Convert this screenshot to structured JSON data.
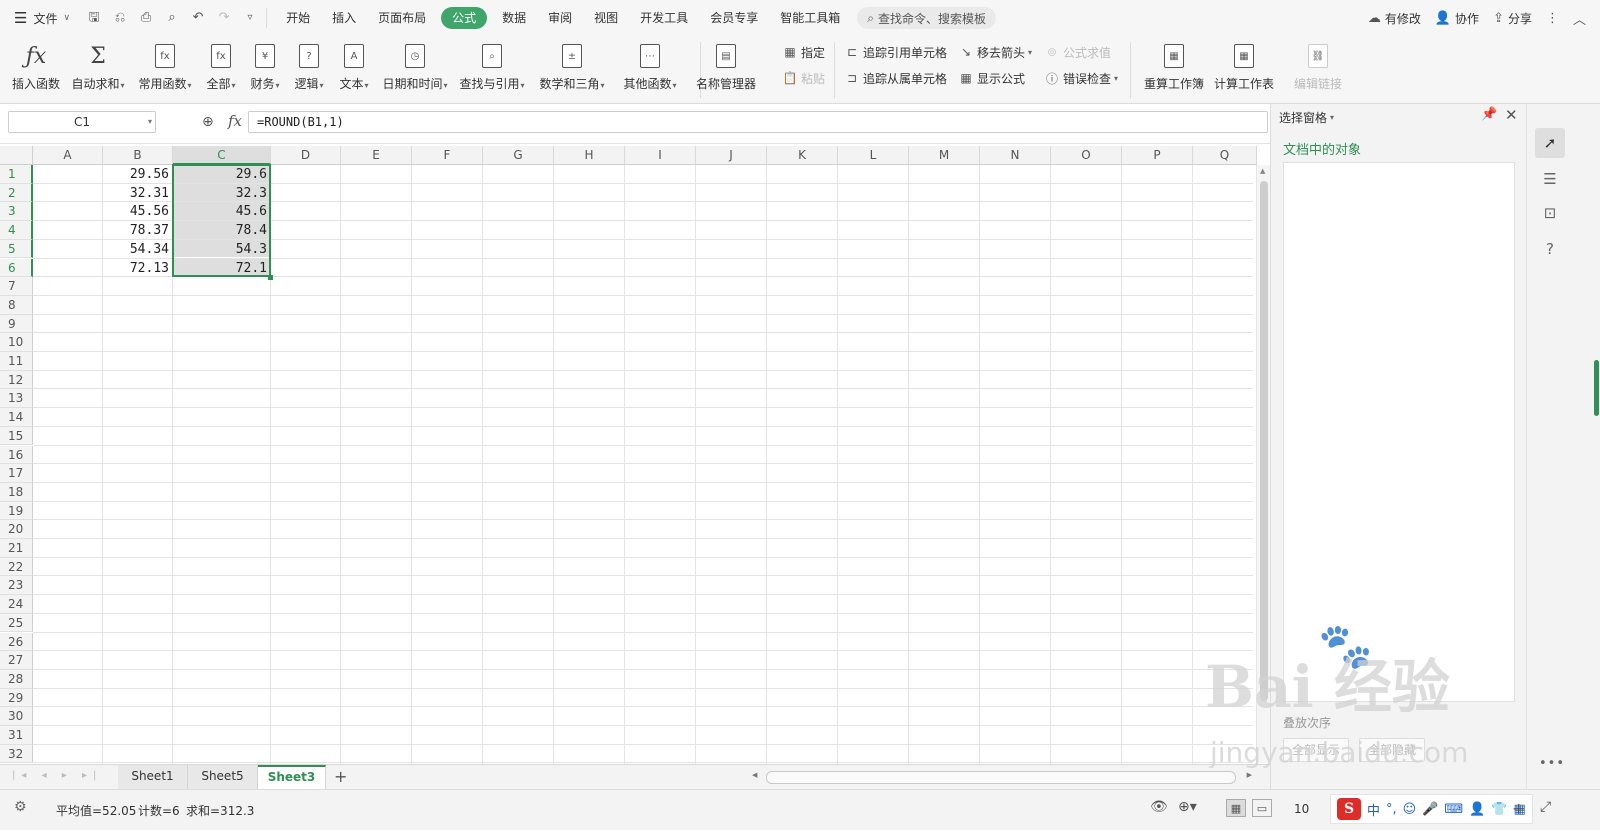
{
  "menubar": {
    "file_label": "文件",
    "tabs": [
      "开始",
      "插入",
      "页面布局",
      "公式",
      "数据",
      "审阅",
      "视图",
      "开发工具",
      "会员专享",
      "智能工具箱"
    ],
    "active_tab": "公式",
    "search_placeholder": "查找命令、搜索模板",
    "right": {
      "modified": "有修改",
      "collab": "协作",
      "share": "分享"
    }
  },
  "ribbon": {
    "big_buttons": [
      {
        "label": "插入函数",
        "icon": "fx-icon",
        "glyph": "ƒx",
        "dropdown": false
      },
      {
        "label": "自动求和",
        "icon": "sigma-icon",
        "glyph": "Σ",
        "dropdown": true
      },
      {
        "label": "常用函数",
        "icon": "common-function-icon",
        "glyph": "fx",
        "dropdown": true
      },
      {
        "label": "全部",
        "icon": "all-function-icon",
        "glyph": "fx",
        "dropdown": true
      },
      {
        "label": "财务",
        "icon": "finance-icon",
        "glyph": "¥",
        "dropdown": true
      },
      {
        "label": "逻辑",
        "icon": "logic-icon",
        "glyph": "?",
        "dropdown": true
      },
      {
        "label": "文本",
        "icon": "text-function-icon",
        "glyph": "A",
        "dropdown": true
      },
      {
        "label": "日期和时间",
        "icon": "clock-icon",
        "glyph": "◷",
        "dropdown": true
      },
      {
        "label": "查找与引用",
        "icon": "lookup-icon",
        "glyph": "⌕",
        "dropdown": true
      },
      {
        "label": "数学和三角",
        "icon": "math-icon",
        "glyph": "±",
        "dropdown": true
      },
      {
        "label": "其他函数",
        "icon": "more-function-icon",
        "glyph": "⋯",
        "dropdown": true
      },
      {
        "label": "名称管理器",
        "icon": "name-manager-icon",
        "glyph": "▤",
        "dropdown": false
      }
    ],
    "small_buttons": {
      "assign": "指定",
      "paste": "粘贴",
      "trace_precedents": "追踪引用单元格",
      "trace_dependents": "追踪从属单元格",
      "remove_arrows": "移去箭头",
      "show_formulas": "显示公式",
      "evaluate_formula": "公式求值",
      "error_check": "错误检查"
    },
    "calc_buttons": [
      {
        "label": "重算工作簿",
        "icon": "recalc-workbook-icon"
      },
      {
        "label": "计算工作表",
        "icon": "calc-sheet-icon"
      }
    ],
    "edit_links": "编辑链接"
  },
  "formula_bar": {
    "name_box": "C1",
    "fx": "fx",
    "formula": "=ROUND(B1,1)"
  },
  "grid": {
    "columns": [
      "A",
      "B",
      "C",
      "D",
      "E",
      "F",
      "G",
      "H",
      "I",
      "J",
      "K",
      "L",
      "M",
      "N",
      "O",
      "P",
      "Q"
    ],
    "selected_column": "C",
    "rows": [
      "1",
      "2",
      "3",
      "4",
      "5",
      "6",
      "7",
      "8",
      "9",
      "10",
      "11",
      "12",
      "13",
      "14",
      "15",
      "16",
      "17",
      "18",
      "19",
      "20",
      "21",
      "22",
      "23",
      "24",
      "25",
      "26",
      "27",
      "28",
      "29",
      "30",
      "31",
      "32"
    ],
    "data": [
      {
        "B": "29.56",
        "C": "29.6"
      },
      {
        "B": "32.31",
        "C": "32.3"
      },
      {
        "B": "45.56",
        "C": "45.6"
      },
      {
        "B": "78.37",
        "C": "78.4"
      },
      {
        "B": "54.34",
        "C": "54.3"
      },
      {
        "B": "72.13",
        "C": "72.1"
      }
    ]
  },
  "sheets": [
    {
      "name": "Sheet1",
      "active": false
    },
    {
      "name": "Sheet5",
      "active": false
    },
    {
      "name": "Sheet3",
      "active": true
    }
  ],
  "status": {
    "average": "平均值=52.05",
    "count": "计数=6",
    "sum": "求和=312.3",
    "zoom": "10"
  },
  "selection_pane": {
    "title": "选择窗格",
    "subtitle": "文档中的对象",
    "sort_label": "叠放次序",
    "show_all": "全部显示",
    "hide_all": "全部隐藏"
  },
  "ime": {
    "mode": "中",
    "punct": "°,"
  },
  "watermark": {
    "logo": "Bai 经验",
    "url": "jingyan.baidu.com"
  },
  "colors": {
    "accent": "#3fa66b",
    "selection": "#2f8f54"
  }
}
